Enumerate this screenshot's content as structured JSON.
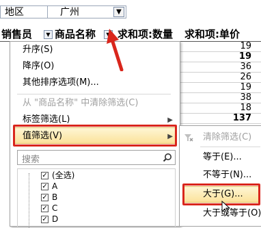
{
  "filter": {
    "label": "地区",
    "value": "广州",
    "dropdown_icon": "filter-dropdown-icon"
  },
  "headers": {
    "salesperson": "销售员",
    "product": "商品名称",
    "sum_qty": "求和项:数量",
    "sum_price": "求和项:单价"
  },
  "price_column": [
    "19",
    "19",
    "36",
    "26",
    "19",
    "38",
    "18",
    "137"
  ],
  "menu": {
    "sort_asc": "升序(S)",
    "sort_desc": "降序(O)",
    "more_sort": "其他排序选项(M)...",
    "clear_filter_from": "从 \"商品名称\" 中清除筛选(C)",
    "label_filter": "标签筛选(L)",
    "value_filter": "值筛选(V)",
    "search_placeholder": "搜索",
    "tree_items": [
      "(全选)",
      "A",
      "B",
      "C",
      "D"
    ]
  },
  "submenu": {
    "clear": "清除筛选(C)",
    "equals": "等于(E)...",
    "not_equals": "不等于(N)...",
    "greater_than": "大于(G)...",
    "greater_equal": "大于或等于(O)..."
  },
  "colors": {
    "highlight": "#fbe29b",
    "annotation_red": "#d9261c"
  }
}
